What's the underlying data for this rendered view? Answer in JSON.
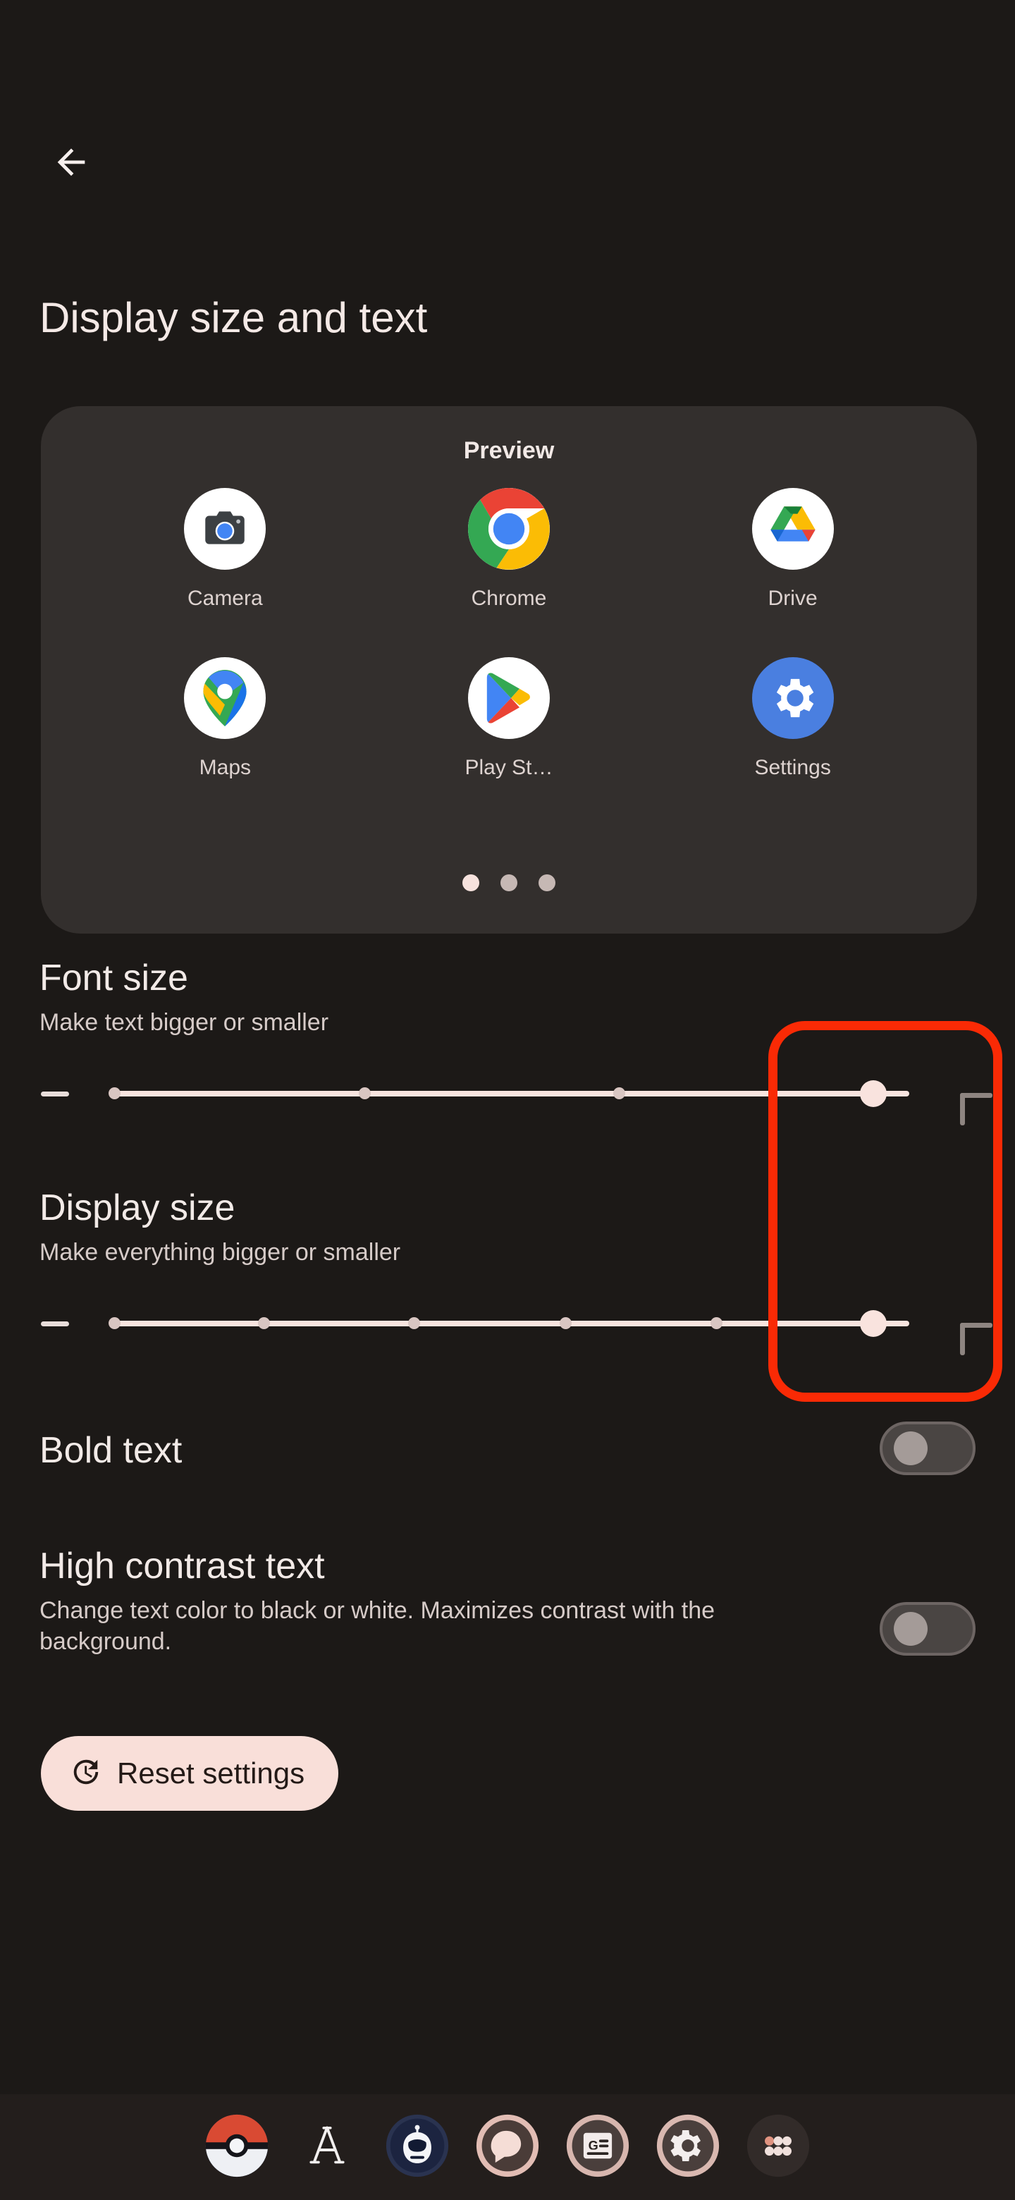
{
  "screen": {
    "title": "Display size and text",
    "back_icon": "arrow-left-icon",
    "background_color": "#1c1917",
    "accent_color": "#f9e3de"
  },
  "preview": {
    "label": "Preview",
    "card_color": "#332f2d",
    "apps": [
      {
        "name": "Camera",
        "icon": "camera-icon",
        "bg": "#ffffff"
      },
      {
        "name": "Chrome",
        "icon": "chrome-icon",
        "bg": "#ffffff"
      },
      {
        "name": "Drive",
        "icon": "drive-icon",
        "bg": "#ffffff"
      },
      {
        "name": "Maps",
        "icon": "maps-icon",
        "bg": "#ffffff"
      },
      {
        "name": "Play St…",
        "icon": "play-store-icon",
        "bg": "#ffffff"
      },
      {
        "name": "Settings",
        "icon": "settings-gear-icon",
        "bg": "#4a7fe0"
      }
    ],
    "pages": {
      "count": 3,
      "active_index": 0
    }
  },
  "font_size": {
    "title": "Font size",
    "subtitle": "Make text bigger or smaller",
    "decrease_label": "−",
    "increase_label": "+",
    "steps": 4,
    "value_index": 3,
    "value_percent": 100
  },
  "display_size": {
    "title": "Display size",
    "subtitle": "Make everything bigger or smaller",
    "decrease_label": "−",
    "increase_label": "+",
    "steps": 6,
    "value_index": 5,
    "value_percent": 100
  },
  "bold_text": {
    "title": "Bold text",
    "enabled": false
  },
  "high_contrast_text": {
    "title": "High contrast text",
    "subtitle": "Change text color to black or white. Maximizes contrast with the background.",
    "enabled": false
  },
  "reset": {
    "label": "Reset settings",
    "icon": "history-restore-icon",
    "bg": "#f9dfd9"
  },
  "annotation": {
    "shape": "rounded-rectangle",
    "color": "#fa2a05"
  },
  "dock": {
    "items": [
      {
        "name": "Pokemon GO",
        "icon": "pokeball-icon"
      },
      {
        "name": "Fonts",
        "icon": "letter-a-icon"
      },
      {
        "name": "Assistant",
        "icon": "robot-head-icon"
      },
      {
        "name": "Messages",
        "icon": "chat-bubble-icon"
      },
      {
        "name": "Google News",
        "icon": "google-news-icon"
      },
      {
        "name": "Settings",
        "icon": "gear-icon"
      },
      {
        "name": "All apps",
        "icon": "app-drawer-dots-icon"
      }
    ]
  }
}
